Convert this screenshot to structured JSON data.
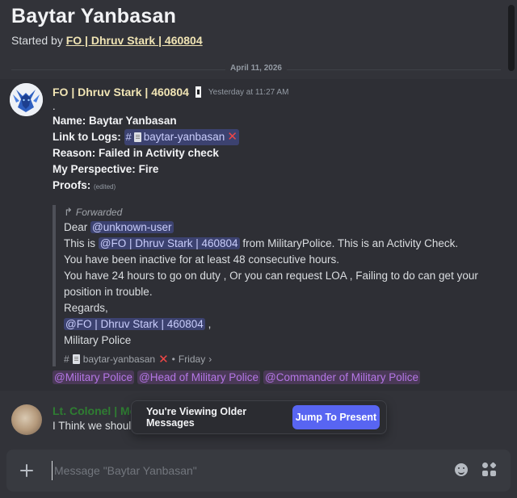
{
  "thread": {
    "title": "Baytar Yanbasan",
    "started_by_prefix": "Started by",
    "started_by_user": "FO | Dhruv Stark | 460804"
  },
  "date_divider": "April 11, 2026",
  "message": {
    "author": "FO | Dhruv Stark | 460804",
    "timestamp": "Yesterday at 11:27 AM",
    "dot": ".",
    "name_label": "Name:",
    "name_value": "Baytar Yanbasan",
    "logs_label": "Link to Logs:",
    "logs_channel": "baytar-yanbasan",
    "reason_label": "Reason:",
    "reason_value": "Failed in Activity check",
    "perspective_label": "My Perspective:",
    "perspective_value": "Fire",
    "proofs_label": "Proofs:",
    "edited": "(edited)",
    "forward": {
      "label": "Forwarded",
      "dear": "Dear",
      "dear_mention": "@unknown-user",
      "this_is": "This is",
      "from_mention": "@FO | Dhruv Stark | 460804",
      "from_rest": "from MilitaryPolice. This is an Activity Check.",
      "line3": "You have been inactive for at least 48 consecutive hours.",
      "line4": "You have 24 hours to go on duty , Or you can request LOA , Failing to do can get your position in trouble.",
      "regards": "Regards,",
      "sign_mention": "@FO | Dhruv Stark | 460804",
      "sign_comma": ",",
      "team": "Military Police",
      "footer_channel": "baytar-yanbasan",
      "footer_day": "Friday"
    },
    "role_mentions": [
      "@Military Police",
      "@Head of Military Police",
      "@Commander of Military Police"
    ]
  },
  "message2": {
    "author": "Lt. Colonel | Me",
    "text": "I Think we shoul"
  },
  "older_toast": {
    "label": "You're Viewing Older Messages",
    "button": "Jump To Present"
  },
  "composer": {
    "placeholder": "Message \"Baytar Yanbasan\""
  },
  "colors": {
    "accent": "#5865f2",
    "author": "#f0e4b4",
    "role_mention": "#b576e6",
    "x_mark": "#f04747"
  }
}
